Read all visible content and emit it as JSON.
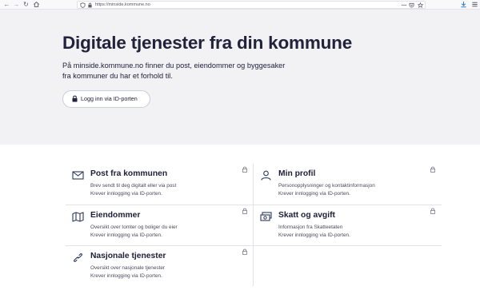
{
  "browser": {
    "url": "https://minside.kommune.no"
  },
  "hero": {
    "title": "Digitale tjenester fra din kommune",
    "intro_line1": "På minside.kommune.no finner du post, eiendommer og byggesaker",
    "intro_line2": "fra kommuner du har et forhold til.",
    "login_label": "Logg inn via ID-porten"
  },
  "services": [
    {
      "title": "Post fra kommunen",
      "line1": "Brev sendt til deg digitalt eller via post",
      "line2": "Krever innlogging via ID-porten.",
      "icon": "mail-icon"
    },
    {
      "title": "Min profil",
      "line1": "Personopplysninger og kontaktinformasjon",
      "line2": "Krever innlogging via ID-porten.",
      "icon": "user-icon"
    },
    {
      "title": "Eiendommer",
      "line1": "Oversikt over tomter og boliger du eier",
      "line2": "Krever innlogging via ID-porten.",
      "icon": "map-icon"
    },
    {
      "title": "Skatt og avgift",
      "line1": "Informasjon fra Skatteetaten",
      "line2": "Krever innlogging via ID-porten.",
      "icon": "money-icon"
    },
    {
      "title": "Nasjonale tjenester",
      "line1": "Oversikt over nasjonale tjenester",
      "line2": "Krever innlogging via ID-porten.",
      "icon": "link-icon"
    }
  ]
}
